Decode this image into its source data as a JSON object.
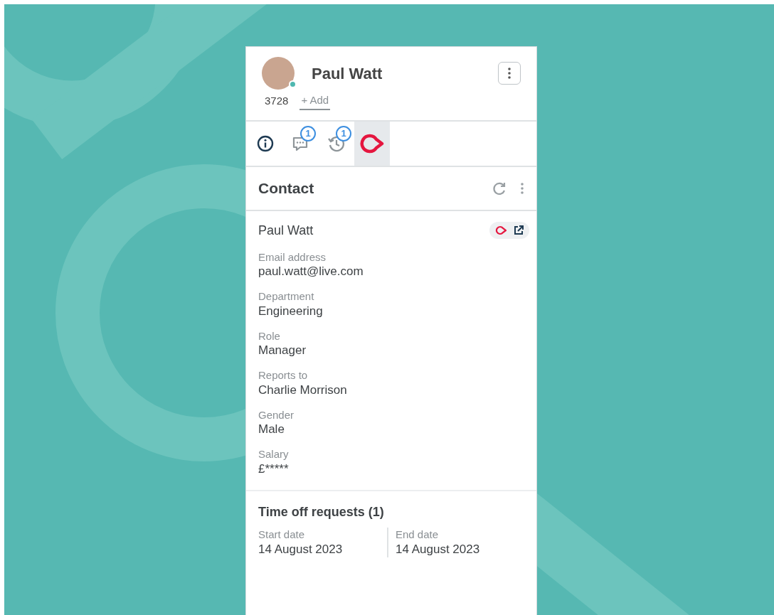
{
  "header": {
    "name": "Paul Watt",
    "extension": "3728",
    "add_label": "+ Add",
    "online": true
  },
  "tabs": [
    {
      "kind": "info",
      "selected": false
    },
    {
      "kind": "chat",
      "badge": "1",
      "selected": false
    },
    {
      "kind": "history",
      "badge": "1",
      "selected": false
    },
    {
      "kind": "brand",
      "selected": true
    }
  ],
  "section": {
    "title": "Contact"
  },
  "contact": {
    "name": "Paul Watt",
    "fields": [
      {
        "label": "Email address",
        "value": "paul.watt@live.com"
      },
      {
        "label": "Department",
        "value": "Engineering"
      },
      {
        "label": "Role",
        "value": "Manager"
      },
      {
        "label": "Reports to",
        "value": "Charlie Morrison"
      },
      {
        "label": "Gender",
        "value": "Male"
      },
      {
        "label": "Salary",
        "value": "£*****"
      }
    ]
  },
  "time_off": {
    "title": "Time off requests (1)",
    "columns": [
      {
        "label": "Start date",
        "value": "14 August 2023"
      },
      {
        "label": "End date",
        "value": "14 August 2023"
      }
    ]
  }
}
